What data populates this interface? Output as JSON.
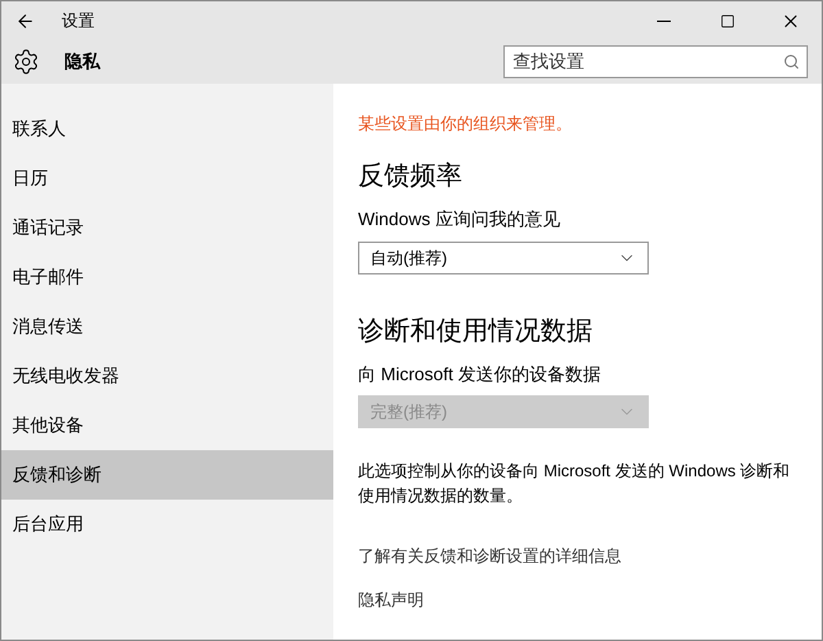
{
  "window": {
    "title": "设置"
  },
  "header": {
    "title": "隐私",
    "search": {
      "placeholder": "查找设置"
    }
  },
  "sidebar": {
    "items": [
      {
        "label": "联系人",
        "selected": false
      },
      {
        "label": "日历",
        "selected": false
      },
      {
        "label": "通话记录",
        "selected": false
      },
      {
        "label": "电子邮件",
        "selected": false
      },
      {
        "label": "消息传送",
        "selected": false
      },
      {
        "label": "无线电收发器",
        "selected": false
      },
      {
        "label": "其他设备",
        "selected": false
      },
      {
        "label": "反馈和诊断",
        "selected": true
      },
      {
        "label": "后台应用",
        "selected": false
      }
    ]
  },
  "content": {
    "notice": "某些设置由你的组织来管理。",
    "sections": [
      {
        "heading": "反馈频率",
        "label": "Windows 应询问我的意见",
        "dropdown": {
          "value": "自动(推荐)",
          "disabled": false
        }
      },
      {
        "heading": "诊断和使用情况数据",
        "label": "向 Microsoft 发送你的设备数据",
        "dropdown": {
          "value": "完整(推荐)",
          "disabled": true
        }
      }
    ],
    "description": "此选项控制从你的设备向 Microsoft 发送的 Windows 诊断和使用情况数据的数量。",
    "links": [
      "了解有关反馈和诊断设置的详细信息",
      "隐私声明"
    ]
  }
}
